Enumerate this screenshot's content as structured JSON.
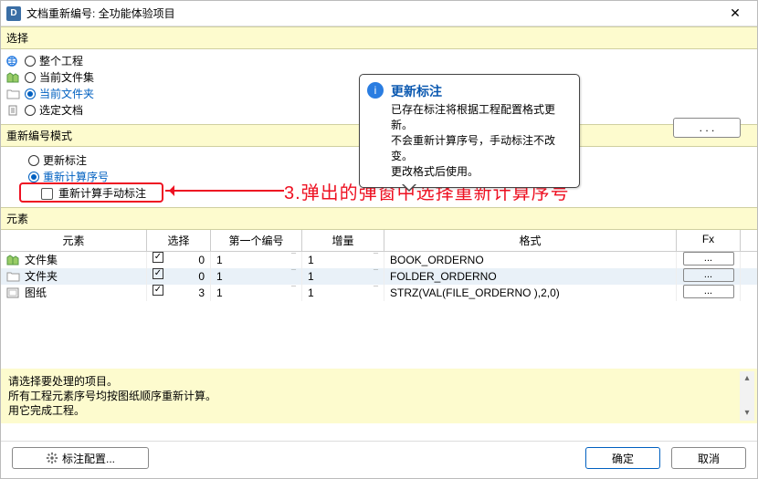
{
  "title": "文档重新编号: 全功能体验项目",
  "sections": {
    "select": "选择",
    "mode": "重新编号模式",
    "elements": "元素"
  },
  "select_radios": {
    "whole_project": "整个工程",
    "current_fileset": "当前文件集",
    "current_folder": "当前文件夹",
    "selected_doc": "选定文档"
  },
  "dots_btn": ". . .",
  "mode_radios": {
    "update": "更新标注",
    "recalc": "重新计算序号",
    "recalc_manual": "重新计算手动标注"
  },
  "annotation_text": "3.弹出的弹窗中选择重新计算序号",
  "tooltip": {
    "title": "更新标注",
    "line1": "已存在标注将根据工程配置格式更新。",
    "line2": "不会重新计算序号，手动标注不改变。",
    "line3": "更改格式后使用。"
  },
  "table": {
    "headers": {
      "element": "元素",
      "sel": "选择",
      "first": "第一个编号",
      "inc": "增量",
      "format": "格式",
      "fx": "Fx"
    },
    "rows": [
      {
        "name": "文件集",
        "sel": "0",
        "first": "1",
        "inc": "1",
        "format": "BOOK_ORDERNO"
      },
      {
        "name": "文件夹",
        "sel": "0",
        "first": "1",
        "inc": "1",
        "format": "FOLDER_ORDERNO"
      },
      {
        "name": "图纸",
        "sel": "3",
        "first": "1",
        "inc": "1",
        "format": "STRZ(VAL(FILE_ORDERNO ),2,0)"
      }
    ],
    "fx_btn": "..."
  },
  "help": {
    "line1": "请选择要处理的项目。",
    "line2": "所有工程元素序号均按图纸顺序重新计算。",
    "line3": "用它完成工程。"
  },
  "buttons": {
    "config": "标注配置...",
    "ok": "确定",
    "cancel": "取消"
  }
}
